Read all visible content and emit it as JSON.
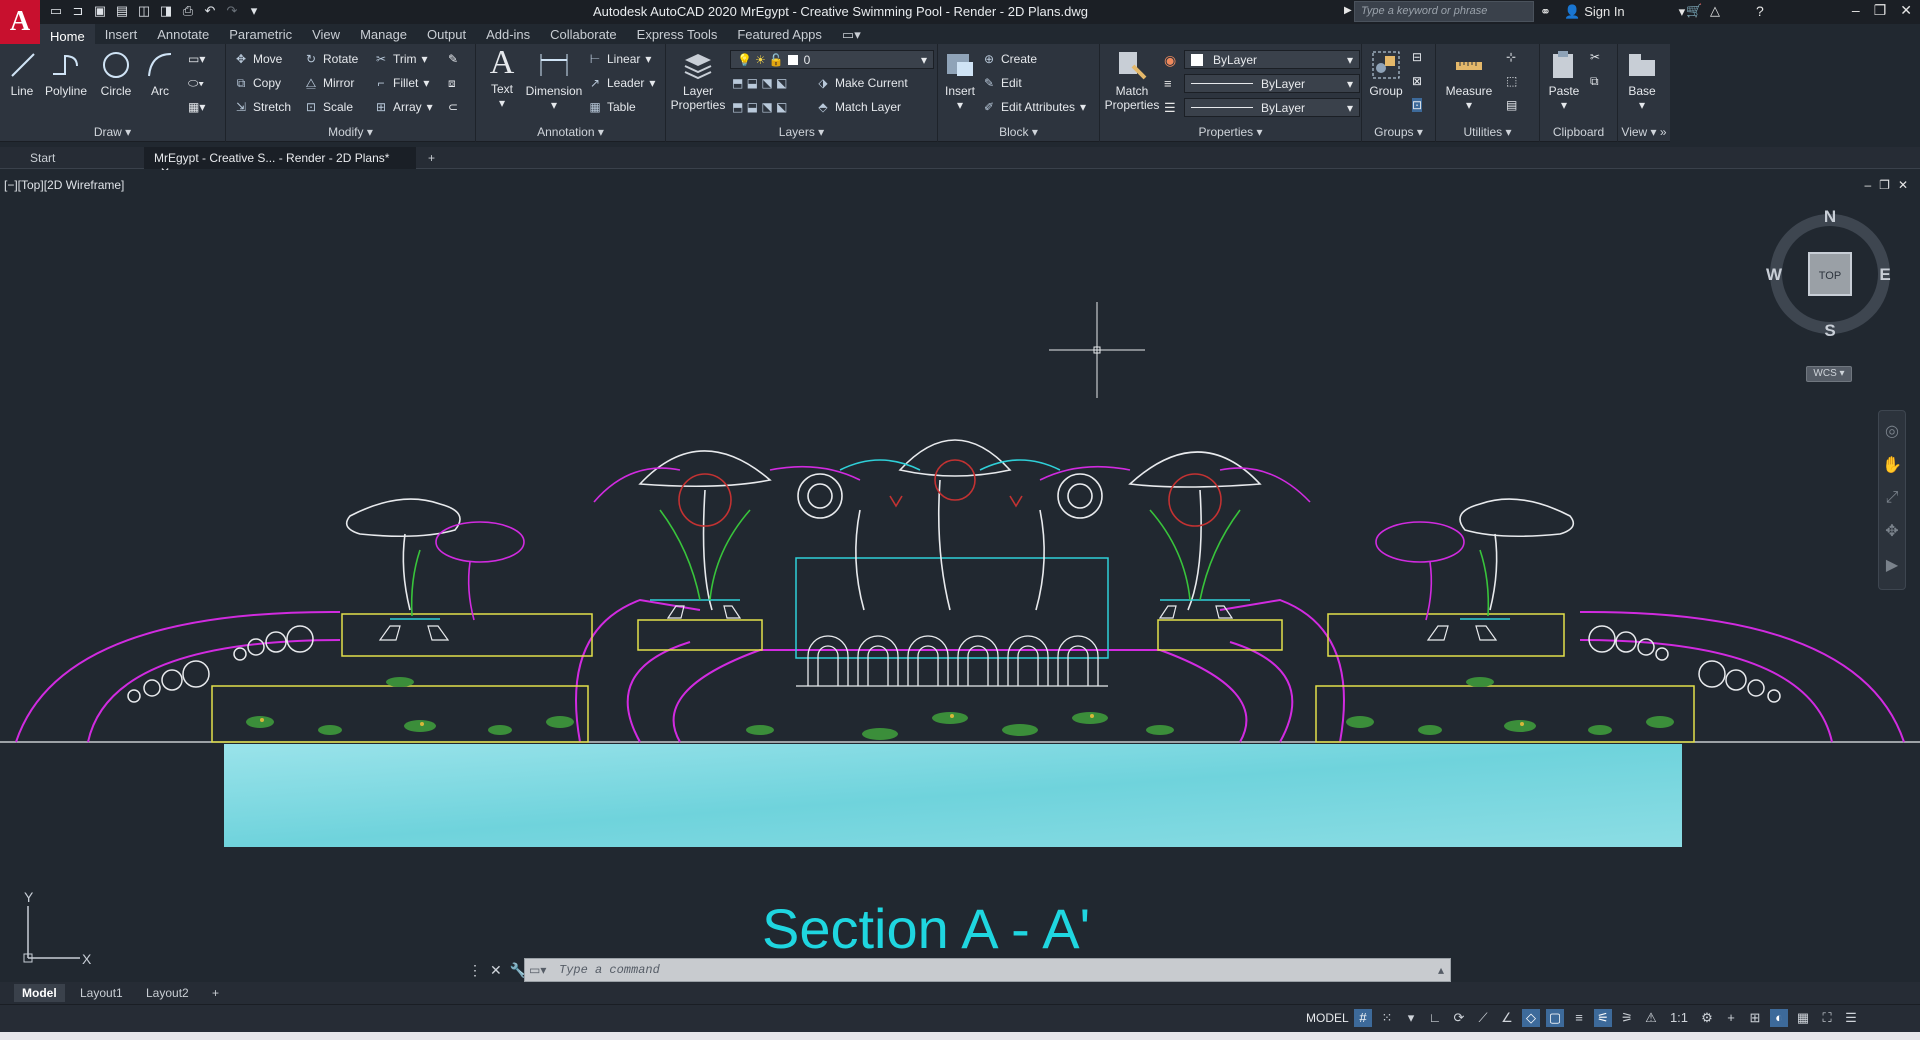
{
  "app": {
    "title": "Autodesk AutoCAD 2020   MrEgypt - Creative Swimming Pool - Render - 2D Plans.dwg",
    "logo_letter": "A",
    "search_placeholder": "Type a keyword or phrase",
    "sign_in": "Sign In"
  },
  "ribbon_tabs": [
    "Home",
    "Insert",
    "Annotate",
    "Parametric",
    "View",
    "Manage",
    "Output",
    "Add-ins",
    "Collaborate",
    "Express Tools",
    "Featured Apps"
  ],
  "draw": {
    "line": "Line",
    "polyline": "Polyline",
    "circle": "Circle",
    "arc": "Arc",
    "title": "Draw"
  },
  "modify": {
    "move": "Move",
    "rotate": "Rotate",
    "trim": "Trim",
    "copy": "Copy",
    "mirror": "Mirror",
    "fillet": "Fillet",
    "stretch": "Stretch",
    "scale": "Scale",
    "array": "Array",
    "title": "Modify"
  },
  "annotation": {
    "text": "Text",
    "dimension": "Dimension",
    "linear": "Linear",
    "leader": "Leader",
    "table": "Table",
    "title": "Annotation"
  },
  "layers": {
    "layer_properties": "Layer Properties",
    "current_layer": "0",
    "make_current": "Make Current",
    "match_layer": "Match Layer",
    "title": "Layers"
  },
  "block": {
    "insert": "Insert",
    "create": "Create",
    "edit": "Edit",
    "edit_attributes": "Edit Attributes",
    "title": "Block"
  },
  "properties": {
    "match_properties": "Match Properties",
    "color": "ByLayer",
    "linetype": "ByLayer",
    "lineweight": "ByLayer",
    "title": "Properties"
  },
  "groups": {
    "group": "Group",
    "title": "Groups"
  },
  "utilities": {
    "measure": "Measure",
    "title": "Utilities"
  },
  "clipboard": {
    "paste": "Paste",
    "title": "Clipboard"
  },
  "view_panel": {
    "base": "Base",
    "title": "View"
  },
  "doc_tabs": {
    "start": "Start",
    "active": "MrEgypt - Creative S... - Render - 2D Plans*"
  },
  "viewport": {
    "label": "[−][Top][2D Wireframe]",
    "section_title": "Section A - A'"
  },
  "viewcube": {
    "n": "N",
    "s": "S",
    "e": "E",
    "w": "W",
    "face": "TOP",
    "wcs": "WCS"
  },
  "ucs": {
    "y": "Y",
    "x": "X"
  },
  "command": {
    "placeholder": "Type a command"
  },
  "layout_tabs": [
    "Model",
    "Layout1",
    "Layout2"
  ],
  "status": {
    "model": "MODEL",
    "scale": "1:1"
  }
}
